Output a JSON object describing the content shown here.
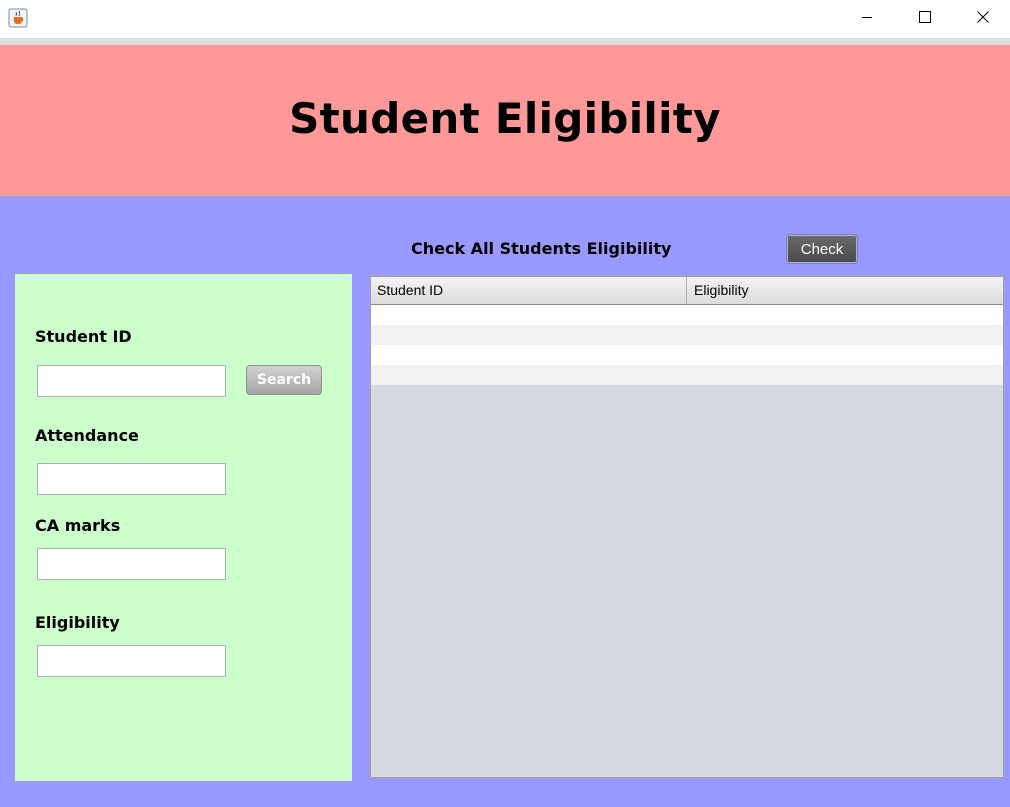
{
  "window": {
    "app_icon": "java-cup-icon",
    "controls": [
      "minimize-icon",
      "maximize-icon",
      "close-icon"
    ]
  },
  "header": {
    "title": "Student Eligibility",
    "background": "#ff9999"
  },
  "main": {
    "background": "#9999ff",
    "check_all_label": "Check All Students Eligibility",
    "check_button_label": "Check"
  },
  "form": {
    "background": "#ccffcc",
    "student_id_label": "Student ID",
    "student_id_value": "",
    "search_button_label": "Search",
    "attendance_label": "Attendance",
    "attendance_value": "",
    "ca_marks_label": "CA marks",
    "ca_marks_value": "",
    "eligibility_label": "Eligibility",
    "eligibility_value": ""
  },
  "table": {
    "columns": [
      "Student ID",
      "Eligibility"
    ],
    "rows": [
      [
        "",
        ""
      ],
      [
        "",
        ""
      ],
      [
        "",
        ""
      ],
      [
        "",
        ""
      ]
    ]
  }
}
